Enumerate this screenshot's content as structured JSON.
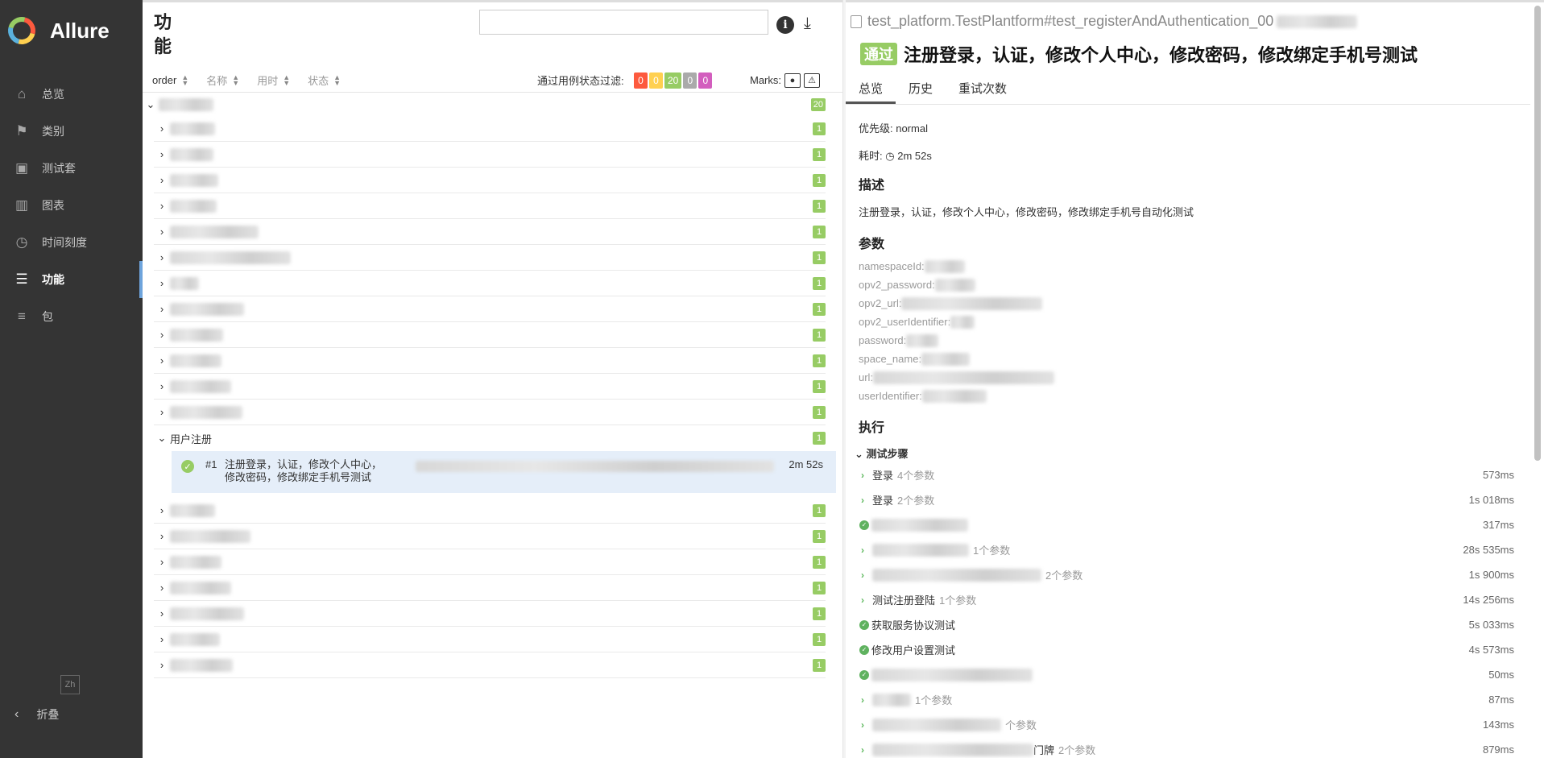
{
  "brand": {
    "name": "Allure"
  },
  "nav": [
    {
      "label": "总览",
      "icon": "home-icon"
    },
    {
      "label": "类别",
      "icon": "flag-icon"
    },
    {
      "label": "测试套",
      "icon": "briefcase-icon"
    },
    {
      "label": "图表",
      "icon": "bar-chart-icon"
    },
    {
      "label": "时间刻度",
      "icon": "clock-icon"
    },
    {
      "label": "功能",
      "icon": "list-icon",
      "active": true
    },
    {
      "label": "包",
      "icon": "align-left-icon"
    }
  ],
  "lang": "Zh",
  "collapse": "折叠",
  "middle": {
    "title": "功能",
    "sort": {
      "order": "order",
      "name": "名称",
      "duration": "用时",
      "status": "状态"
    },
    "filter_label": "通过用例状态过滤:",
    "filters": {
      "failed": "0",
      "broken": "0",
      "passed": "20",
      "skipped": "0",
      "unknown": "0"
    },
    "marks_label": "Marks:",
    "root_count": "20",
    "group_label": "用户注册",
    "row_count": "1",
    "leaf": {
      "num": "#1",
      "name": "注册登录，认证，修改个人中心，修改密码，修改绑定手机号测试",
      "duration": "2m 52s"
    }
  },
  "right": {
    "fullname": "test_platform.TestPlantform#test_registerAndAuthentication_00",
    "status": "通过",
    "title": "注册登录，认证，修改个人中心，修改密码，修改绑定手机号测试",
    "tabs": [
      "总览",
      "历史",
      "重试次数"
    ],
    "severity": "优先级: normal",
    "duration_label": "耗时:",
    "duration": "2m 52s",
    "desc_title": "描述",
    "desc": "注册登录，认证，修改个人中心，修改密码，修改绑定手机号自动化测试",
    "params_title": "参数",
    "params": [
      "namespaceId:",
      "opv2_password:",
      "opv2_url:",
      "opv2_userIdentifier:",
      "password:",
      "space_name:",
      "url:",
      "userIdentifier:"
    ],
    "exec_title": "执行",
    "steps_title": "测试步骤",
    "steps": [
      {
        "name": "登录",
        "params": "4个参数",
        "time": "573ms",
        "kind": "chev"
      },
      {
        "name": "登录",
        "params": "2个参数",
        "time": "1s 018ms",
        "kind": "chev"
      },
      {
        "name": "",
        "params": "",
        "time": "317ms",
        "kind": "ok"
      },
      {
        "name": "",
        "params": "1个参数",
        "time": "28s 535ms",
        "kind": "chev"
      },
      {
        "name": "",
        "params": "2个参数",
        "time": "1s 900ms",
        "kind": "chev"
      },
      {
        "name": "测试注册登陆",
        "params": "1个参数",
        "time": "14s 256ms",
        "kind": "chev"
      },
      {
        "name": "获取服务协议测试",
        "params": "",
        "time": "5s 033ms",
        "kind": "ok"
      },
      {
        "name": "修改用户设置测试",
        "params": "",
        "time": "4s 573ms",
        "kind": "ok"
      },
      {
        "name": "",
        "params": "",
        "time": "50ms",
        "kind": "ok"
      },
      {
        "name": "",
        "params": "1个参数",
        "time": "87ms",
        "kind": "chev"
      },
      {
        "name": "",
        "params": "个参数",
        "time": "143ms",
        "kind": "chev"
      },
      {
        "name": "门牌",
        "params": "2个参数",
        "time": "879ms",
        "kind": "chev"
      }
    ]
  }
}
